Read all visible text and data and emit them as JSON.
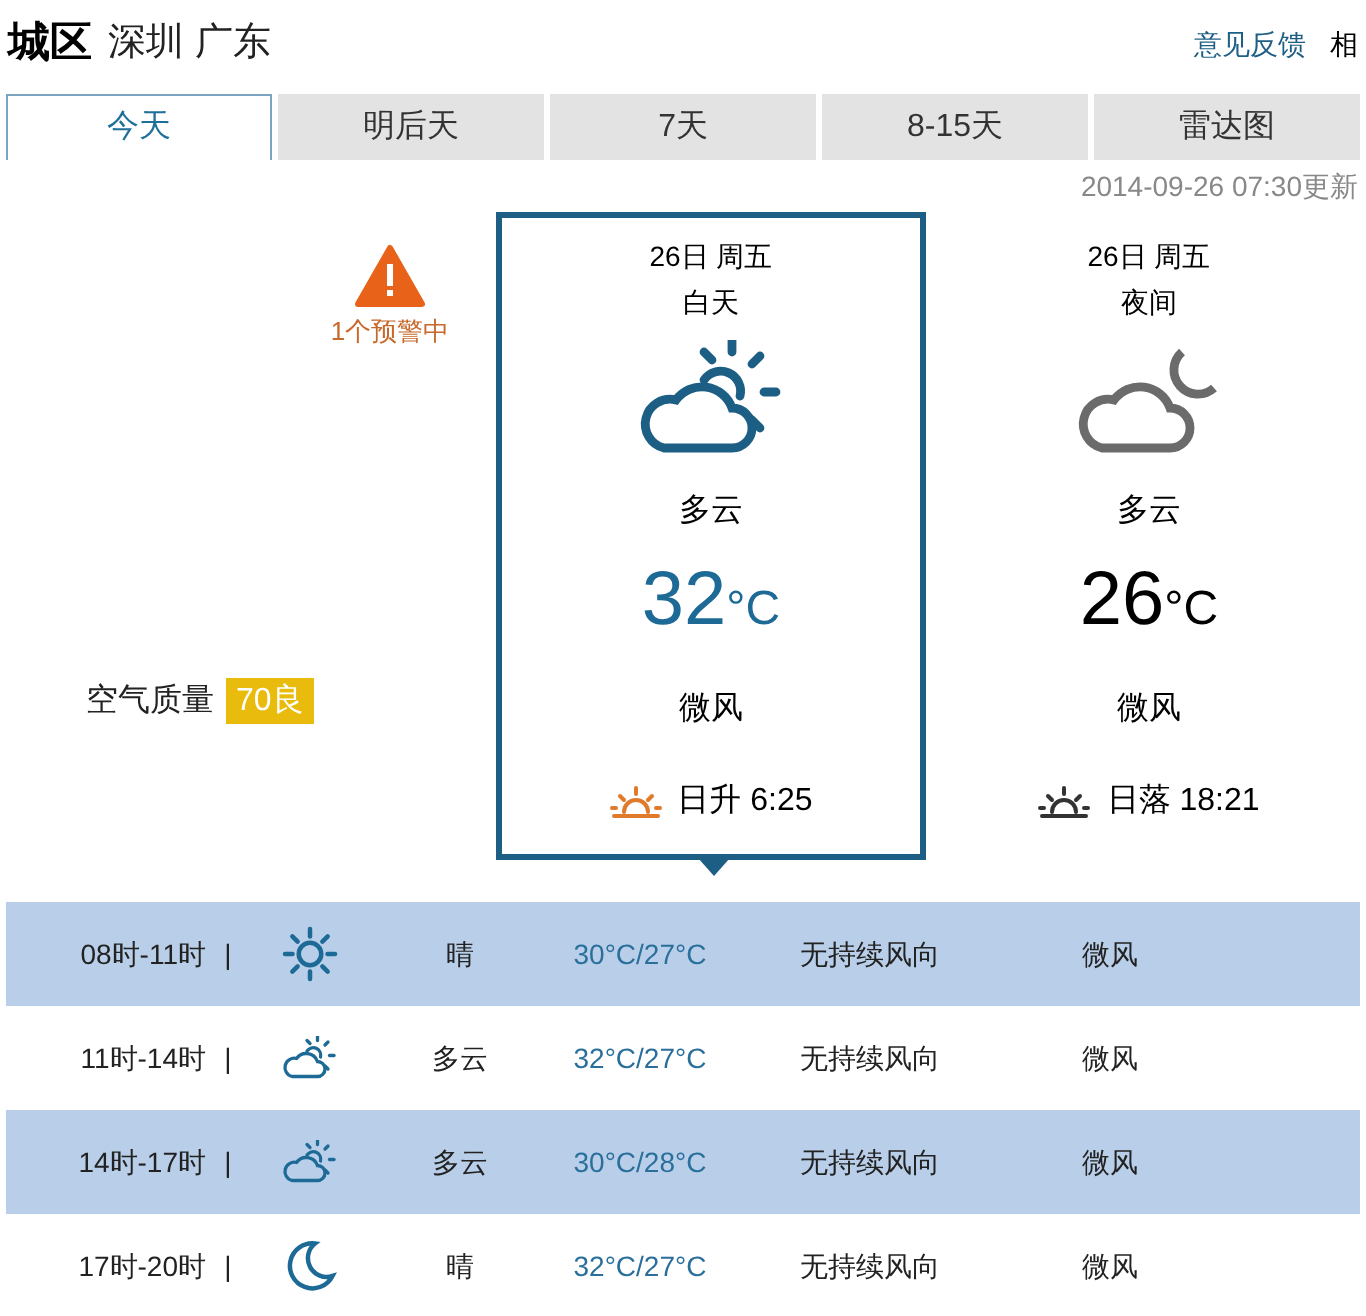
{
  "header": {
    "title": "城区",
    "location": "深圳 广东",
    "links": [
      "意见反馈",
      "相"
    ]
  },
  "tabs": [
    {
      "label": "今天",
      "selected": true
    },
    {
      "label": "明后天",
      "selected": false
    },
    {
      "label": "7天",
      "selected": false
    },
    {
      "label": "8-15天",
      "selected": false
    },
    {
      "label": "雷达图",
      "selected": false
    }
  ],
  "updated": "2014-09-26 07:30更新",
  "warning": {
    "label": "1个预警中"
  },
  "air_quality": {
    "label": "空气质量",
    "badge": "70良"
  },
  "periods": [
    {
      "date": "26日 周五",
      "period": "白天",
      "kind": "day",
      "weather": "多云",
      "temp": "32",
      "unit": "°C",
      "wind": "微风",
      "sun": "日升 6:25",
      "selected": true
    },
    {
      "date": "26日 周五",
      "period": "夜间",
      "kind": "night",
      "weather": "多云",
      "temp": "26",
      "unit": "°C",
      "wind": "微风",
      "sun": "日落 18:21",
      "selected": false
    }
  ],
  "hourly": [
    {
      "time": "08时-11时",
      "sep": "|",
      "kind": "clear",
      "weather": "晴",
      "temp": "30°C/27°C",
      "wind_dir": "无持续风向",
      "wind": "微风"
    },
    {
      "time": "11时-14时",
      "sep": "|",
      "kind": "cloudy",
      "weather": "多云",
      "temp": "32°C/27°C",
      "wind_dir": "无持续风向",
      "wind": "微风"
    },
    {
      "time": "14时-17时",
      "sep": "|",
      "kind": "cloudy",
      "weather": "多云",
      "temp": "30°C/28°C",
      "wind_dir": "无持续风向",
      "wind": "微风"
    },
    {
      "time": "17时-20时",
      "sep": "|",
      "kind": "clear-night",
      "weather": "晴",
      "temp": "32°C/27°C",
      "wind_dir": "无持续风向",
      "wind": "微风"
    }
  ]
}
